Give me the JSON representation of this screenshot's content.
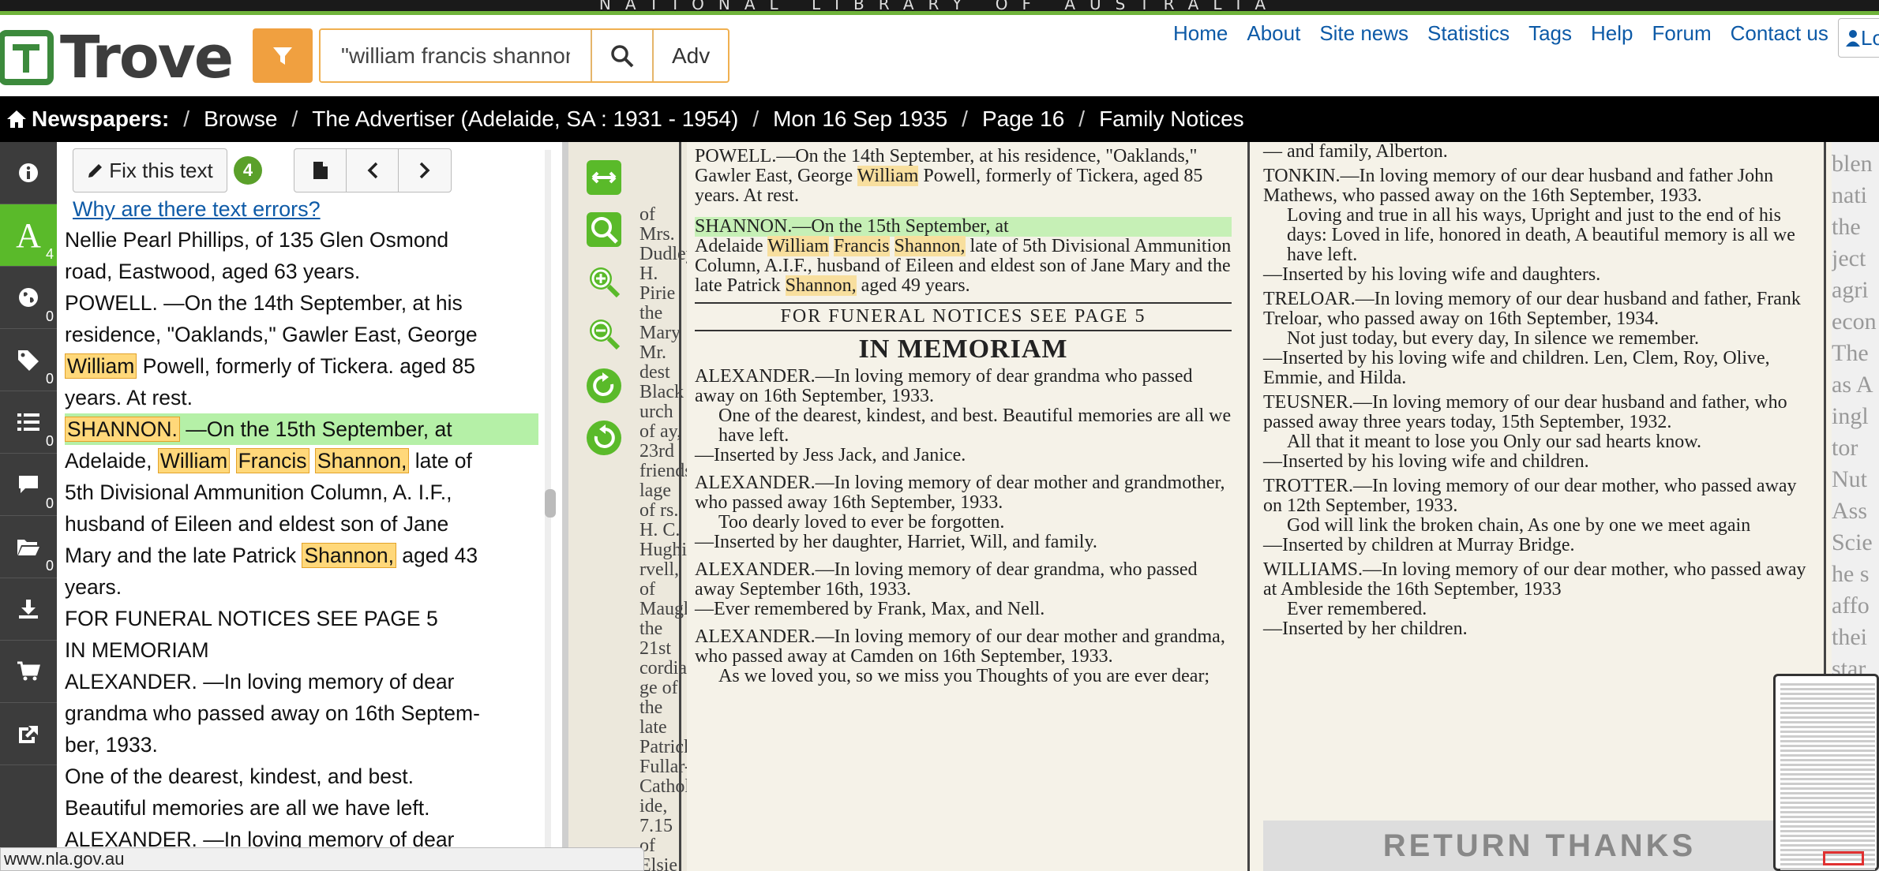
{
  "banner": {
    "text": "NATIONAL LIBRARY OF AUSTRALIA"
  },
  "logo": {
    "text": "Trove"
  },
  "search": {
    "value": "\"william francis shannon\"",
    "adv_label": "Adv"
  },
  "topnav": [
    "Home",
    "About",
    "Site news",
    "Statistics",
    "Tags",
    "Help",
    "Forum",
    "Contact us"
  ],
  "login": {
    "label": "Lo"
  },
  "breadcrumb": {
    "root": "Newspapers:",
    "items": [
      "Browse",
      "The Advertiser (Adelaide, SA : 1931 - 1954)",
      "Mon 16 Sep 1935",
      "Page 16",
      "Family Notices"
    ]
  },
  "rail": {
    "items": [
      {
        "name": "info-icon",
        "count": ""
      },
      {
        "name": "text-icon",
        "count": "4"
      },
      {
        "name": "globe-icon",
        "count": "0"
      },
      {
        "name": "tag-icon",
        "count": "0"
      },
      {
        "name": "list-icon",
        "count": "0"
      },
      {
        "name": "comment-icon",
        "count": "0"
      },
      {
        "name": "folder-icon",
        "count": "0"
      },
      {
        "name": "download-icon",
        "count": ""
      },
      {
        "name": "cart-icon",
        "count": ""
      },
      {
        "name": "share-icon",
        "count": ""
      }
    ]
  },
  "textpanel": {
    "fix_label": "Fix this text",
    "fix_count": "4",
    "why_link": "Why are there text errors?",
    "lines": {
      "l1": "Nellie Pearl Phillips, of 135 Glen Osmond",
      "l2": "road, Eastwood, aged 63 years.",
      "l3": "POWELL. —On the 14th September, at his",
      "l4": "residence, \"Oaklands,\" Gawler East, George",
      "l5a": "William",
      "l5b": " Powell, formerly of Tickera. aged 85",
      "l6": "years. At rest.",
      "l7a": "SHANNON.",
      "l7b": " —On the 15th September, at",
      "l8a": "Adelaide, ",
      "l8b": "William",
      "l8c": "Francis",
      "l8d": "Shannon,",
      "l8e": " late of",
      "l9": "5th Divisional Ammunition Column, A. I.F.,",
      "l10": "husband of Eileen and eldest son of Jane",
      "l11a": "Mary and the late Patrick ",
      "l11b": "Shannon,",
      "l11c": " aged 43",
      "l12": "years.",
      "l13": "FOR FUNERAL NOTICES SEE PAGE 5",
      "l14": "IN MEMORIAM",
      "l15": "ALEXANDER. —In loving memory of dear",
      "l16": "grandma who passed away on 16th Septem-",
      "l17": "ber, 1933.",
      "l18": "One of the dearest, kindest, and best.",
      "l19": "Beautiful memories are all we have left.",
      "l20": "ALEXANDER. —In loving memory of dear"
    }
  },
  "newspaper": {
    "left_fragments": "of Mrs. Dudley, H. Pirie the Mary Mr. dest Black urch of ay, 23rd friends lage of rs. H. C. Hughie), rvell, of Maughan the 21st cordially ge of the late Patrick, Fullar- Catholic ide, 7.15 of Elsie",
    "mid": {
      "powell": "POWELL.—On the 14th September, at his residence, \"Oaklands,\" Gawler East, George",
      "powell_hl": "William",
      "powell_end": " Powell, formerly of Tickera, aged 85 years. At rest.",
      "shannon_line": "SHANNON.—On the 15th September, at",
      "shannon_a": "Adelaide ",
      "shannon_w": "William",
      "shannon_f": "Francis",
      "shannon_s": "Shannon,",
      "shannon_b": " late of 5th Divisional Ammunition Column, A.I.F., husband of Eileen and eldest son of Jane Mary and the late Patrick ",
      "shannon_c": " aged 49 years.",
      "funeral": "FOR FUNERAL NOTICES SEE PAGE 5",
      "memoriam": "IN MEMORIAM",
      "alex1": "ALEXANDER.—In loving memory of dear grandma who passed away on 16th September, 1933.",
      "alex1_verse": "One of the dearest, kindest, and best. Beautiful memories are all we have left.",
      "alex1_sig": "—Inserted by Jess Jack, and Janice.",
      "alex2": "ALEXANDER.—In loving memory of dear mother and grandmother, who passed away 16th September, 1933.",
      "alex2_verse": "Too dearly loved to ever be forgotten.",
      "alex2_sig": "—Inserted by her daughter, Harriet, Will, and family.",
      "alex3": "ALEXANDER.—In loving memory of dear grandma, who passed away September 16th, 1933.",
      "alex3_sig": "—Ever remembered by Frank, Max, and Nell.",
      "alex4": "ALEXANDER.—In loving memory of our dear mother and grandma, who passed away at Camden on 16th September, 1933.",
      "alex4_verse": "As we loved you, so we miss you Thoughts of you are ever dear;"
    },
    "right": {
      "top": "— and family, Alberton.",
      "tonkin": "TONKIN.—In loving memory of our dear husband and father John Mathews, who passed away on the 16th September, 1933.",
      "tonkin_verse": "Loving and true in all his ways, Upright and just to the end of his days: Loved in life, honored in death, A beautiful memory is all we have left.",
      "tonkin_sig": "—Inserted by his loving wife and daughters.",
      "treloar": "TRELOAR.—In loving memory of our dear husband and father, Frank Treloar, who passed away on 16th September, 1934.",
      "treloar_verse": "Not just today, but every day, In silence we remember.",
      "treloar_sig": "—Inserted by his loving wife and children. Len, Clem, Roy, Olive, Emmie, and Hilda.",
      "teusner": "TEUSNER.—In loving memory of our dear husband and father, who passed away three years today, 15th September, 1932.",
      "teusner_verse": "All that it meant to lose you Only our sad hearts know.",
      "teusner_sig": "—Inserted by his loving wife and children.",
      "trotter": "TROTTER.—In loving memory of our dear mother, who passed away on 12th September, 1933.",
      "trotter_verse": "God will link the broken chain, As one by one we meet again",
      "trotter_sig": "—Inserted by children at Murray Bridge.",
      "williams": "WILLIAMS.—In loving memory of our dear mother, who passed away at Ambleside the 16th September, 1933",
      "williams_verse": "Ever remembered.",
      "williams_sig": "—Inserted by her children."
    },
    "return_thanks": "RETURN THANKS",
    "edge_text": "blen nati the ject agri econ The as A ingl tor Nut Ass Scie he s affo thei star"
  },
  "status_url": "www.nla.gov.au",
  "colors": {
    "accent_green": "#5aba2a",
    "search_orange": "#f0a040",
    "link_blue": "#0d5aa7",
    "highlight": "#ffd87a"
  }
}
